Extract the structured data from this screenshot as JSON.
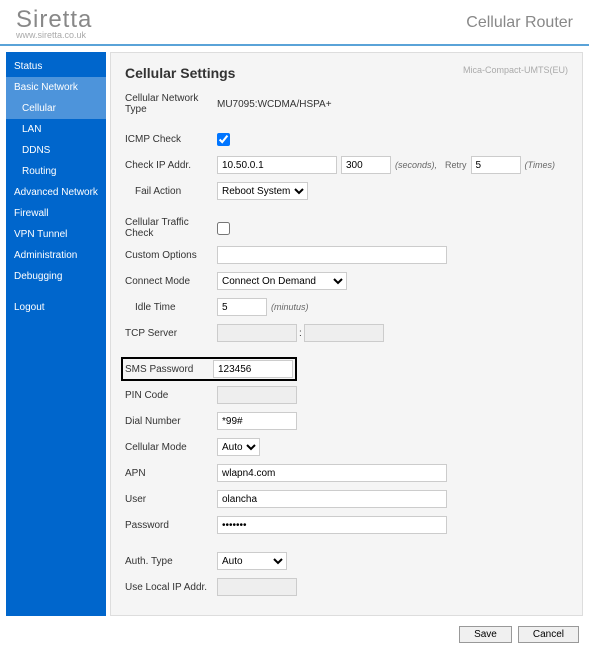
{
  "brand": {
    "name": "Siretta",
    "url": "www.siretta.co.uk"
  },
  "header": {
    "product": "Cellular Router"
  },
  "model": "Mica-Compact-UMTS(EU)",
  "sidebar": {
    "items": [
      {
        "label": "Status"
      },
      {
        "label": "Basic Network"
      },
      {
        "label": "Cellular"
      },
      {
        "label": "LAN"
      },
      {
        "label": "DDNS"
      },
      {
        "label": "Routing"
      },
      {
        "label": "Advanced Network"
      },
      {
        "label": "Firewall"
      },
      {
        "label": "VPN Tunnel"
      },
      {
        "label": "Administration"
      },
      {
        "label": "Debugging"
      },
      {
        "label": "Logout"
      }
    ]
  },
  "page": {
    "title": "Cellular Settings",
    "labels": {
      "cell_net_type": "Cellular Network Type",
      "icmp_check": "ICMP Check",
      "check_ip": "Check IP Addr.",
      "fail_action": "Fail Action",
      "traffic_check": "Cellular Traffic Check",
      "custom_options": "Custom Options",
      "connect_mode": "Connect Mode",
      "idle_time": "Idle Time",
      "tcp_server": "TCP Server",
      "sms_password": "SMS Password",
      "pin_code": "PIN Code",
      "dial_number": "Dial Number",
      "cellular_mode": "Cellular Mode",
      "apn": "APN",
      "user": "User",
      "password": "Password",
      "auth_type": "Auth. Type",
      "use_local_ip": "Use Local IP Addr."
    },
    "values": {
      "cell_net_type": "MU7095:WCDMA/HSPA+",
      "check_ip": "10.50.0.1",
      "check_ip_timeout": "300",
      "check_ip_retry": "5",
      "fail_action": "Reboot System",
      "connect_mode": "Connect On Demand",
      "idle_time": "5",
      "sms_password": "123456",
      "dial_number": "*99#",
      "cellular_mode": "Auto",
      "apn": "wlapn4.com",
      "user": "olancha",
      "password": "•••••••",
      "auth_type": "Auto",
      "tcp_server_host": "",
      "tcp_server_port": "",
      "custom_options": "",
      "pin_code": "",
      "use_local_ip": ""
    },
    "suffix": {
      "seconds": "(seconds),",
      "retry": "Retry",
      "times": "(Times)",
      "minutus": "(minutus)",
      "colon": ":"
    }
  },
  "footer": {
    "save": "Save",
    "cancel": "Cancel"
  }
}
